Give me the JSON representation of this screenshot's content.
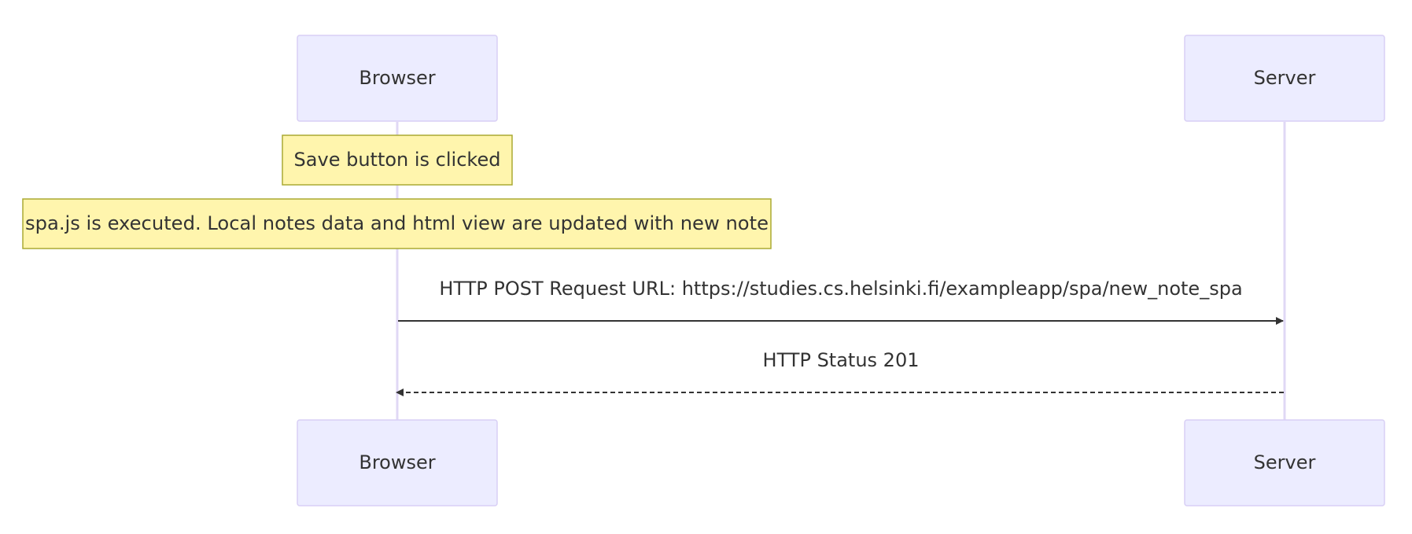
{
  "participants": [
    {
      "id": "browser",
      "label": "Browser"
    },
    {
      "id": "server",
      "label": "Server"
    }
  ],
  "notes": [
    {
      "over": "browser",
      "text": "Save button is clicked"
    },
    {
      "over": "browser",
      "text": "spa.js is executed. Local notes data and html view are updated with new note"
    }
  ],
  "messages": [
    {
      "from": "browser",
      "to": "server",
      "style": "solid",
      "text": "HTTP POST Request URL: https://studies.cs.helsinki.fi/exampleapp/spa/new_note_spa"
    },
    {
      "from": "server",
      "to": "browser",
      "style": "dashed",
      "text": "HTTP Status 201"
    }
  ],
  "colors": {
    "actor_fill": "#ECECFF",
    "actor_stroke": "#D8CFF5",
    "lifeline": "#E0D8F5",
    "note_fill": "#FFF5AD",
    "note_stroke": "#AAAA33",
    "arrow": "#333333",
    "text": "#333333"
  }
}
